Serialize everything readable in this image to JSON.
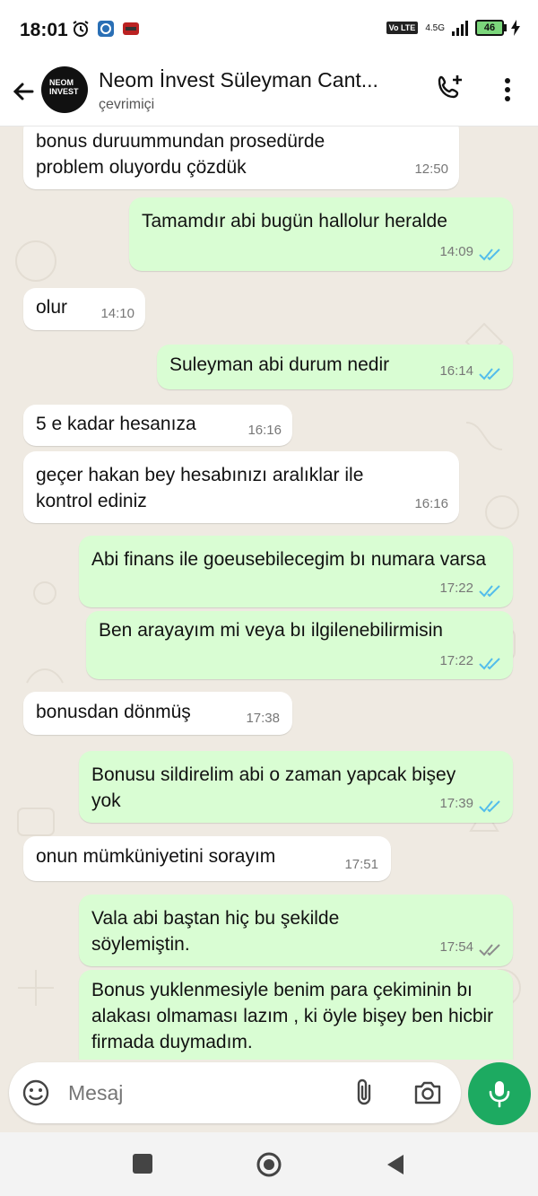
{
  "status_bar": {
    "time": "18:01",
    "network": "4.5G",
    "volte": "Vo LTE",
    "battery": "46"
  },
  "header": {
    "contact_name": "Neom İnvest Süleyman Cant...",
    "status": "çevrimiçi",
    "avatar_text": "NEOM INVEST"
  },
  "messages": [
    {
      "dir": "in",
      "text": "bonus duruummundan prosedürde problem oluyordu çözdük",
      "time": "12:50"
    },
    {
      "dir": "out",
      "text": "Tamamdır abi bugün hallolur heralde",
      "time": "14:09",
      "status": "read"
    },
    {
      "dir": "in",
      "text": "olur",
      "time": "14:10"
    },
    {
      "dir": "out",
      "text": "Suleyman abi durum nedir",
      "time": "16:14",
      "status": "read"
    },
    {
      "dir": "in",
      "text": "5 e kadar hesanıza",
      "time": "16:16"
    },
    {
      "dir": "in",
      "text": "geçer hakan bey hesabınızı aralıklar ile kontrol ediniz",
      "time": "16:16"
    },
    {
      "dir": "out",
      "text": "Abi finans ile goeusebilecegim bı numara varsa",
      "time": "17:22",
      "status": "read"
    },
    {
      "dir": "out",
      "text": "Ben arayayım mi veya bı ilgilenebilirmisin",
      "time": "17:22",
      "status": "read"
    },
    {
      "dir": "in",
      "text": "bonusdan dönmüş",
      "time": "17:38"
    },
    {
      "dir": "out",
      "text": "Bonusu sildirelim abi o zaman yapcak bişey yok",
      "time": "17:39",
      "status": "read"
    },
    {
      "dir": "in",
      "text": "onun mümküniyetini sorayım",
      "time": "17:51"
    },
    {
      "dir": "out",
      "text": "Vala abi baştan hiç bu şekilde söylemiştin.",
      "time": "17:54",
      "status": "delivered"
    },
    {
      "dir": "out",
      "text": "Bonus yuklenmesiyle benim para çekiminin bı alakası olmaması lazım , ki öyle bişey ben hicbir firmada duymadım.",
      "time": ""
    }
  ],
  "input": {
    "placeholder": "Mesaj"
  },
  "colors": {
    "incoming_bubble": "#ffffff",
    "outgoing_bubble": "#d9fdd3",
    "read_tick": "#53bdeb",
    "delivered_tick": "#8c8c8c",
    "mic_button": "#1daa61",
    "wallpaper": "#efeae2"
  }
}
